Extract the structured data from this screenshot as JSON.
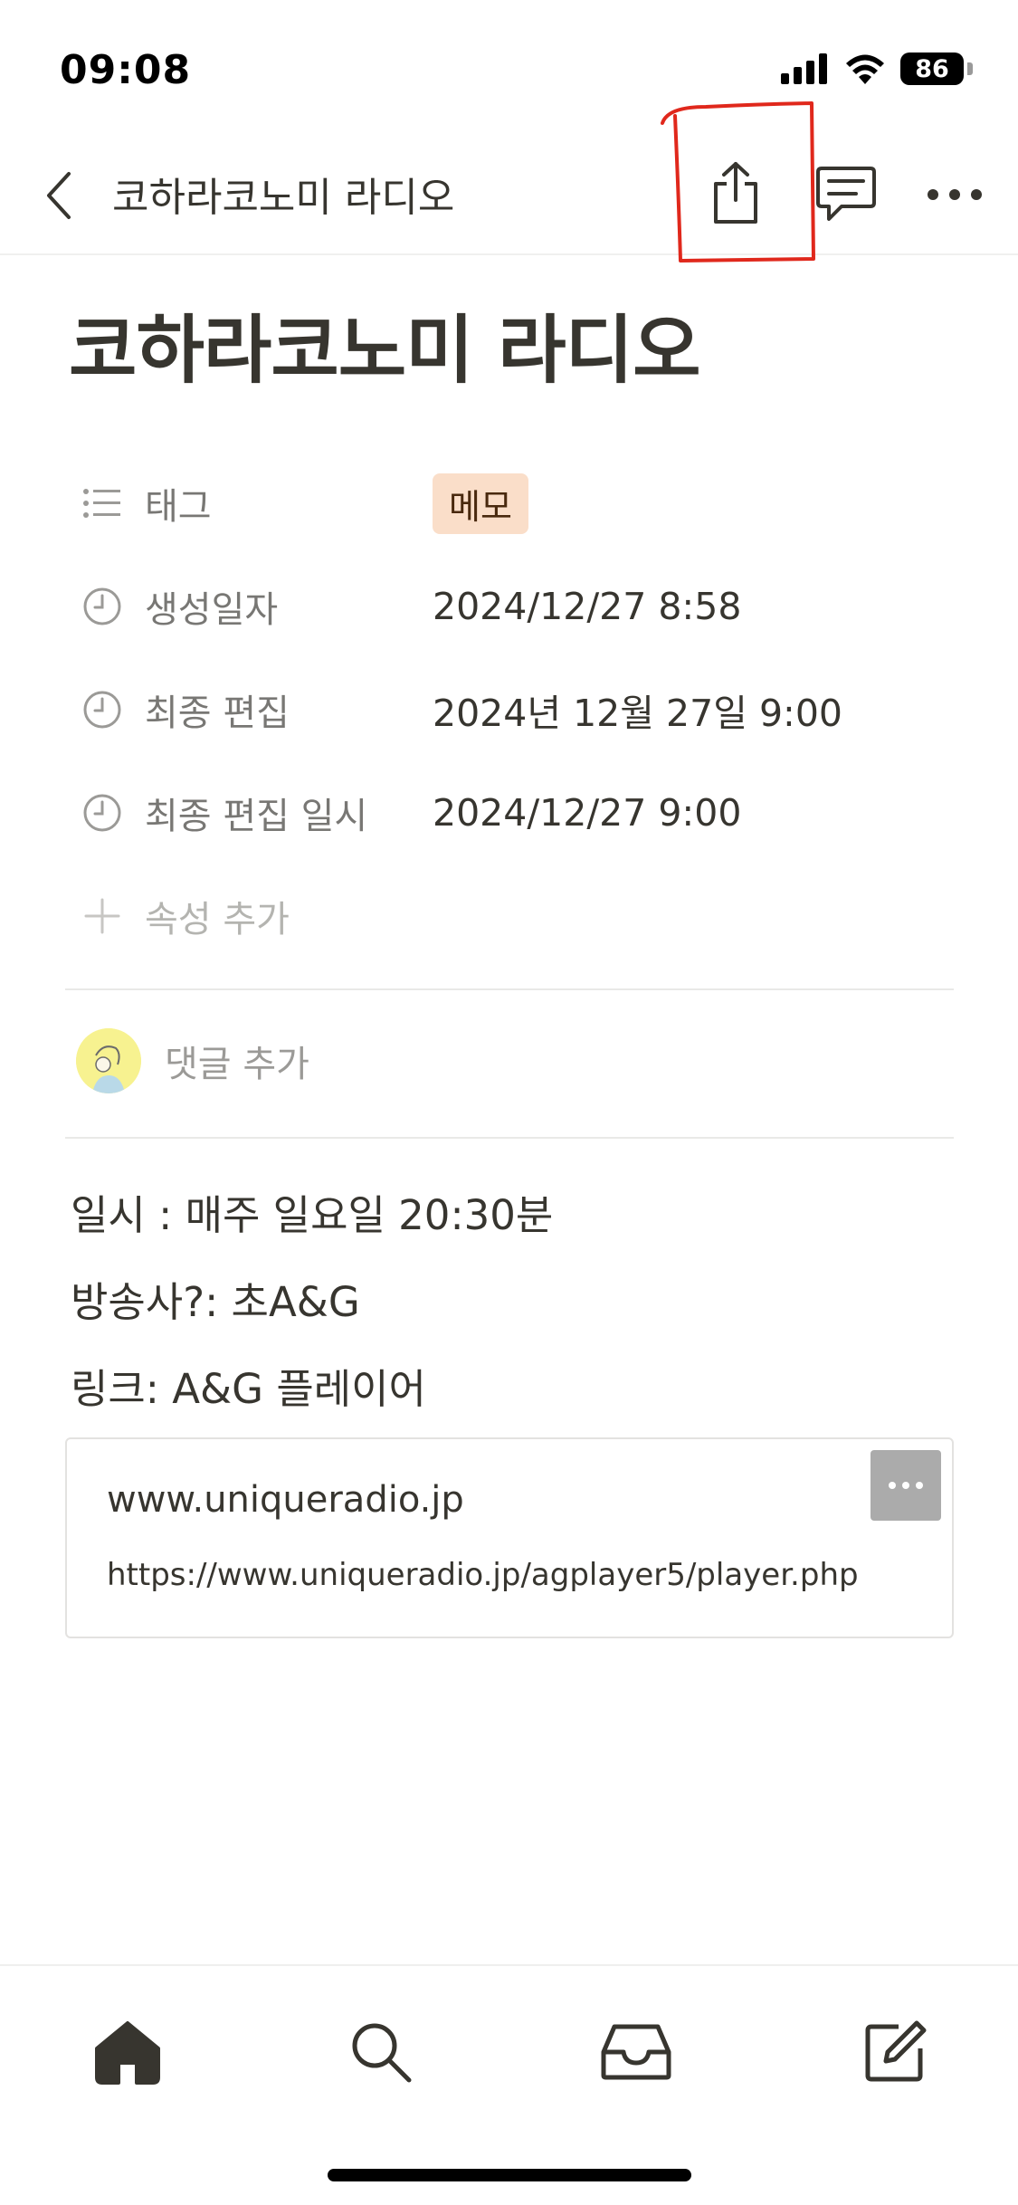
{
  "status_bar": {
    "time": "09:08",
    "battery": "86",
    "icons": [
      "cellular-signal-icon",
      "wifi-icon",
      "battery-icon"
    ]
  },
  "header": {
    "title": "코하라코노미 라디오",
    "icons": [
      "chevron-left-icon",
      "share-icon",
      "comment-icon",
      "more-horizontal-icon"
    ],
    "annotation_color": "#e0281c"
  },
  "page": {
    "title": "코하라코노미 라디오"
  },
  "properties": [
    {
      "icon": "list-icon",
      "label": "태그",
      "value": "메모",
      "type": "tag",
      "tag_bg": "#fadec9"
    },
    {
      "icon": "clock-icon",
      "label": "생성일자",
      "value": "2024/12/27 8:58"
    },
    {
      "icon": "clock-icon",
      "label": "최종 편집",
      "value": "2024년 12월 27일 9:00"
    },
    {
      "icon": "clock-icon",
      "label": "최종 편집 일시",
      "value": "2024/12/27 9:00"
    }
  ],
  "add_property": {
    "icon": "plus-icon",
    "label": "속성 추가"
  },
  "comment": {
    "placeholder": "댓글 추가"
  },
  "body": [
    "일시 : 매주 일요일 20:30분",
    "방송사?: 초A&G",
    "링크: A&G 플레이어"
  ],
  "bookmark": {
    "title": "www.uniqueradio.jp",
    "url": "https://www.uniqueradio.jp/agplayer5/player.php"
  },
  "bottom_nav": {
    "items": [
      "home-icon",
      "search-icon",
      "inbox-icon",
      "compose-icon"
    ]
  },
  "colors": {
    "text": "#37352f",
    "muted": "#787774",
    "tag_bg": "#fadec9"
  }
}
